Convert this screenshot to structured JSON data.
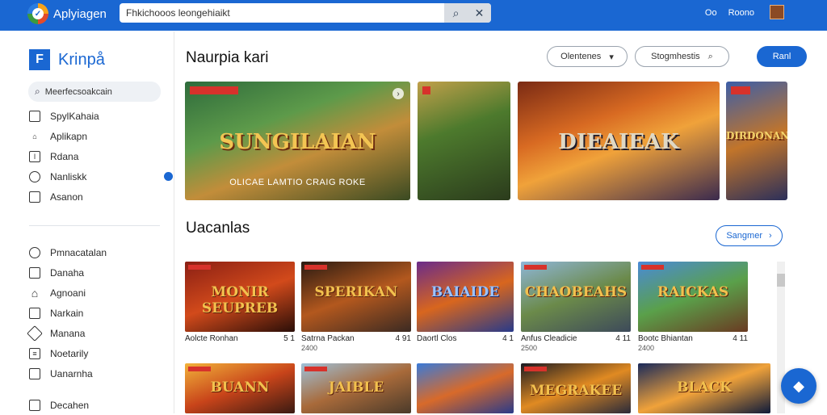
{
  "topbar": {
    "app_title": "Aplyiagen",
    "search_value": "Fhkichooos leongehiaikt",
    "right_label_1": "Oo",
    "right_label_2": "Roono"
  },
  "sidebar": {
    "brand": "Krinpå",
    "search_label": "Meerfecsoakcain",
    "group1": [
      {
        "label": "SpylKahaia"
      },
      {
        "label": "Aplikapn"
      },
      {
        "label": "Rdana"
      },
      {
        "label": "Nanliskk"
      },
      {
        "label": "Asanon"
      }
    ],
    "group2": [
      {
        "label": "Pmnacatalan"
      },
      {
        "label": "Danaha"
      },
      {
        "label": "Agnoani"
      },
      {
        "label": "Narkain"
      },
      {
        "label": "Manana"
      },
      {
        "label": "Noetarily"
      },
      {
        "label": "Uanarnha"
      },
      {
        "label": "Decahen"
      }
    ]
  },
  "main": {
    "title": "Naurpia kari",
    "dropdown": "Olentenes",
    "search_btn": "Stogmhestis",
    "primary_btn": "Ranl",
    "banners": [
      {
        "title": "SUNGILAIAN",
        "subtitle": "OLICAE LAMTIO CRAIG ROKE"
      },
      {
        "title": ""
      },
      {
        "title": "DIEAIEAK"
      },
      {
        "title": "DIRDONAN"
      }
    ],
    "section_title": "Uacanlas",
    "see_all": "Sangmer",
    "row1": [
      {
        "thumb": "MONIR SEUPREB",
        "name": "Aolcte Ronhan",
        "rating": "5 1",
        "sub": ""
      },
      {
        "thumb": "SPERIKAN",
        "name": "Satrna Packan",
        "rating": "4 91",
        "sub": "2400"
      },
      {
        "thumb": "BAIAIDE",
        "name": "Daortl Clos",
        "rating": "4 1",
        "sub": ""
      },
      {
        "thumb": "CHAOBEAHS",
        "name": "Anfus Cleadicie",
        "rating": "4 11",
        "sub": "2500"
      },
      {
        "thumb": "RAICKAS",
        "name": "Bootc Bhiantan",
        "rating": "4 11",
        "sub": "2400"
      }
    ],
    "row2": [
      {
        "thumb": "BUANN"
      },
      {
        "thumb": "JAIBLE"
      },
      {
        "thumb": ""
      },
      {
        "thumb": "MEGRAKEE"
      },
      {
        "thumb": "BLACK"
      }
    ]
  },
  "colors": {
    "brand_blue": "#1a67d2",
    "red_tag": "#d7322b"
  }
}
